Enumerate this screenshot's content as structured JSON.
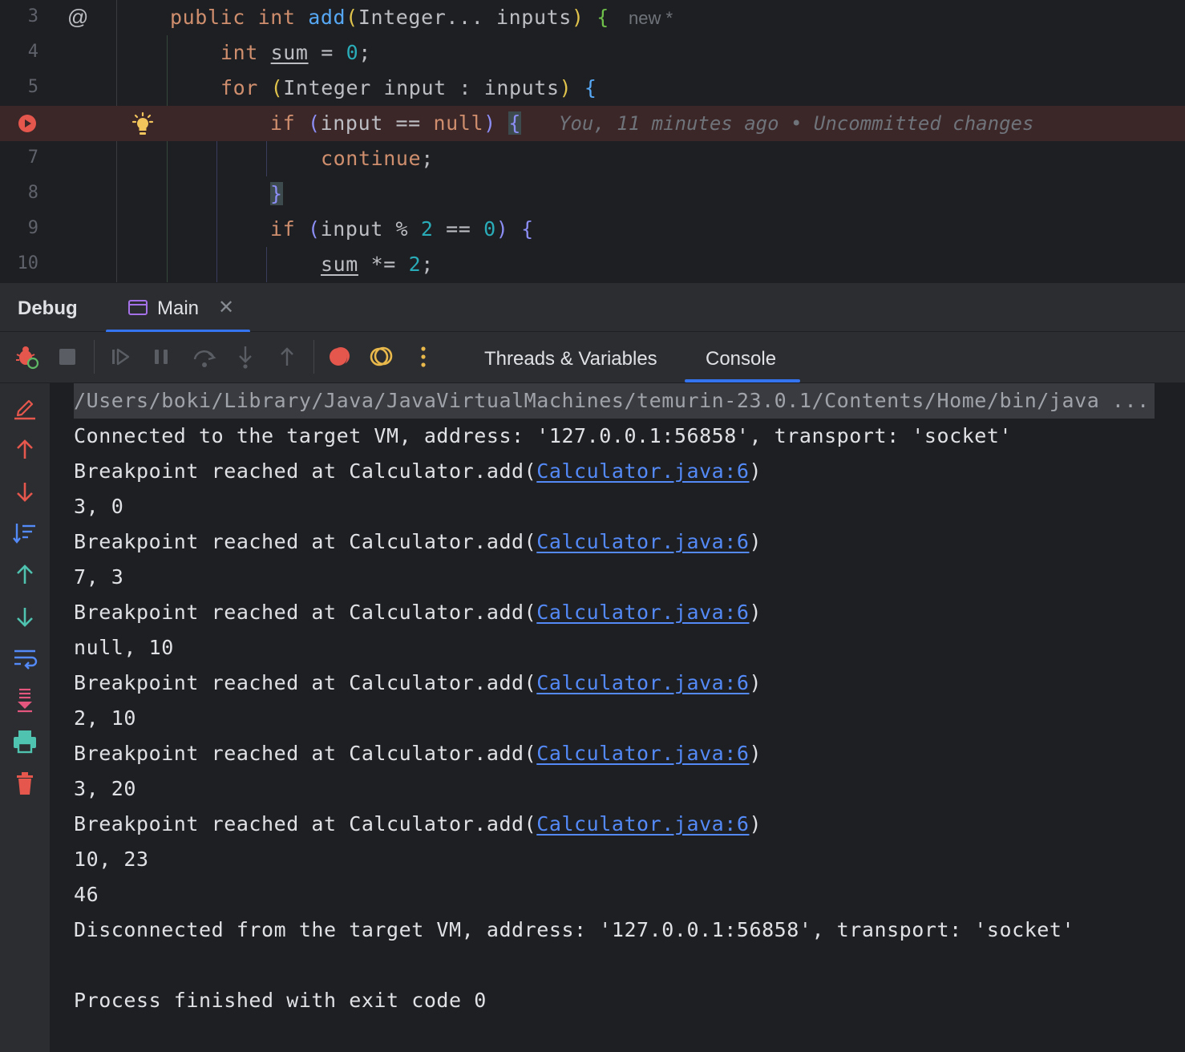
{
  "editor": {
    "lines": [
      {
        "num": "3"
      },
      {
        "num": "4"
      },
      {
        "num": "5"
      },
      {
        "num": "6"
      },
      {
        "num": "7"
      },
      {
        "num": "8"
      },
      {
        "num": "9"
      },
      {
        "num": "10"
      }
    ],
    "code": {
      "l3_public": "public",
      "l3_int": "int",
      "l3_add": "add",
      "l3_rest": "Integer... inputs",
      "l4_int": "int",
      "l4_sum": "sum",
      "l4_rest": " = ",
      "l4_zero": "0",
      "l4_semi": ";",
      "l5_for": "for",
      "l5_rest": "Integer input : inputs",
      "l6_if": "if",
      "l6_rest": "input == ",
      "l6_null": "null",
      "l7_continue": "continue",
      "l7_semi": ";",
      "l9_if": "if",
      "l9_a": "input % ",
      "l9_two": "2",
      "l9_b": " == ",
      "l9_zero": "0",
      "l10_sum": "sum",
      "l10_op": " *= ",
      "l10_two": "2",
      "l10_semi": ";"
    },
    "annotation_marker": "@",
    "inline_hint": "new *",
    "blame": "You, 11 minutes ago • Uncommitted changes"
  },
  "debug_panel": {
    "title": "Debug",
    "run_tab": {
      "label": "Main",
      "close": "✕"
    },
    "tabs": [
      {
        "label": "Threads & Variables",
        "active": false
      },
      {
        "label": "Console",
        "active": true
      }
    ]
  },
  "toolbar_icons": [
    "rerun-debug-icon",
    "stop-icon",
    "resume-icon",
    "pause-icon",
    "step-over-icon",
    "step-into-icon",
    "step-out-icon",
    "view-breakpoints-icon",
    "mute-breakpoints-icon",
    "more-icon"
  ],
  "console": {
    "command": "/Users/boki/Library/Java/JavaVirtualMachines/temurin-23.0.1/Contents/Home/bin/java ...",
    "lines": [
      {
        "text": "Connected to the target VM, address: '127.0.0.1:56858', transport: 'socket'"
      },
      {
        "prefix": "Breakpoint reached at Calculator.add(",
        "link": "Calculator.java:6",
        "suffix": ")"
      },
      {
        "text": "3, 0"
      },
      {
        "prefix": "Breakpoint reached at Calculator.add(",
        "link": "Calculator.java:6",
        "suffix": ")"
      },
      {
        "text": "7, 3"
      },
      {
        "prefix": "Breakpoint reached at Calculator.add(",
        "link": "Calculator.java:6",
        "suffix": ")"
      },
      {
        "text": "null, 10"
      },
      {
        "prefix": "Breakpoint reached at Calculator.add(",
        "link": "Calculator.java:6",
        "suffix": ")"
      },
      {
        "text": "2, 10"
      },
      {
        "prefix": "Breakpoint reached at Calculator.add(",
        "link": "Calculator.java:6",
        "suffix": ")"
      },
      {
        "text": "3, 20"
      },
      {
        "prefix": "Breakpoint reached at Calculator.add(",
        "link": "Calculator.java:6",
        "suffix": ")"
      },
      {
        "text": "10, 23"
      },
      {
        "text": "46"
      },
      {
        "text": "Disconnected from the target VM, address: '127.0.0.1:56858', transport: 'socket'"
      },
      {
        "text": ""
      },
      {
        "text": "Process finished with exit code 0"
      }
    ]
  },
  "colors": {
    "accent": "#3574f0",
    "breakpoint": "#e5564d",
    "link": "#548af7"
  }
}
